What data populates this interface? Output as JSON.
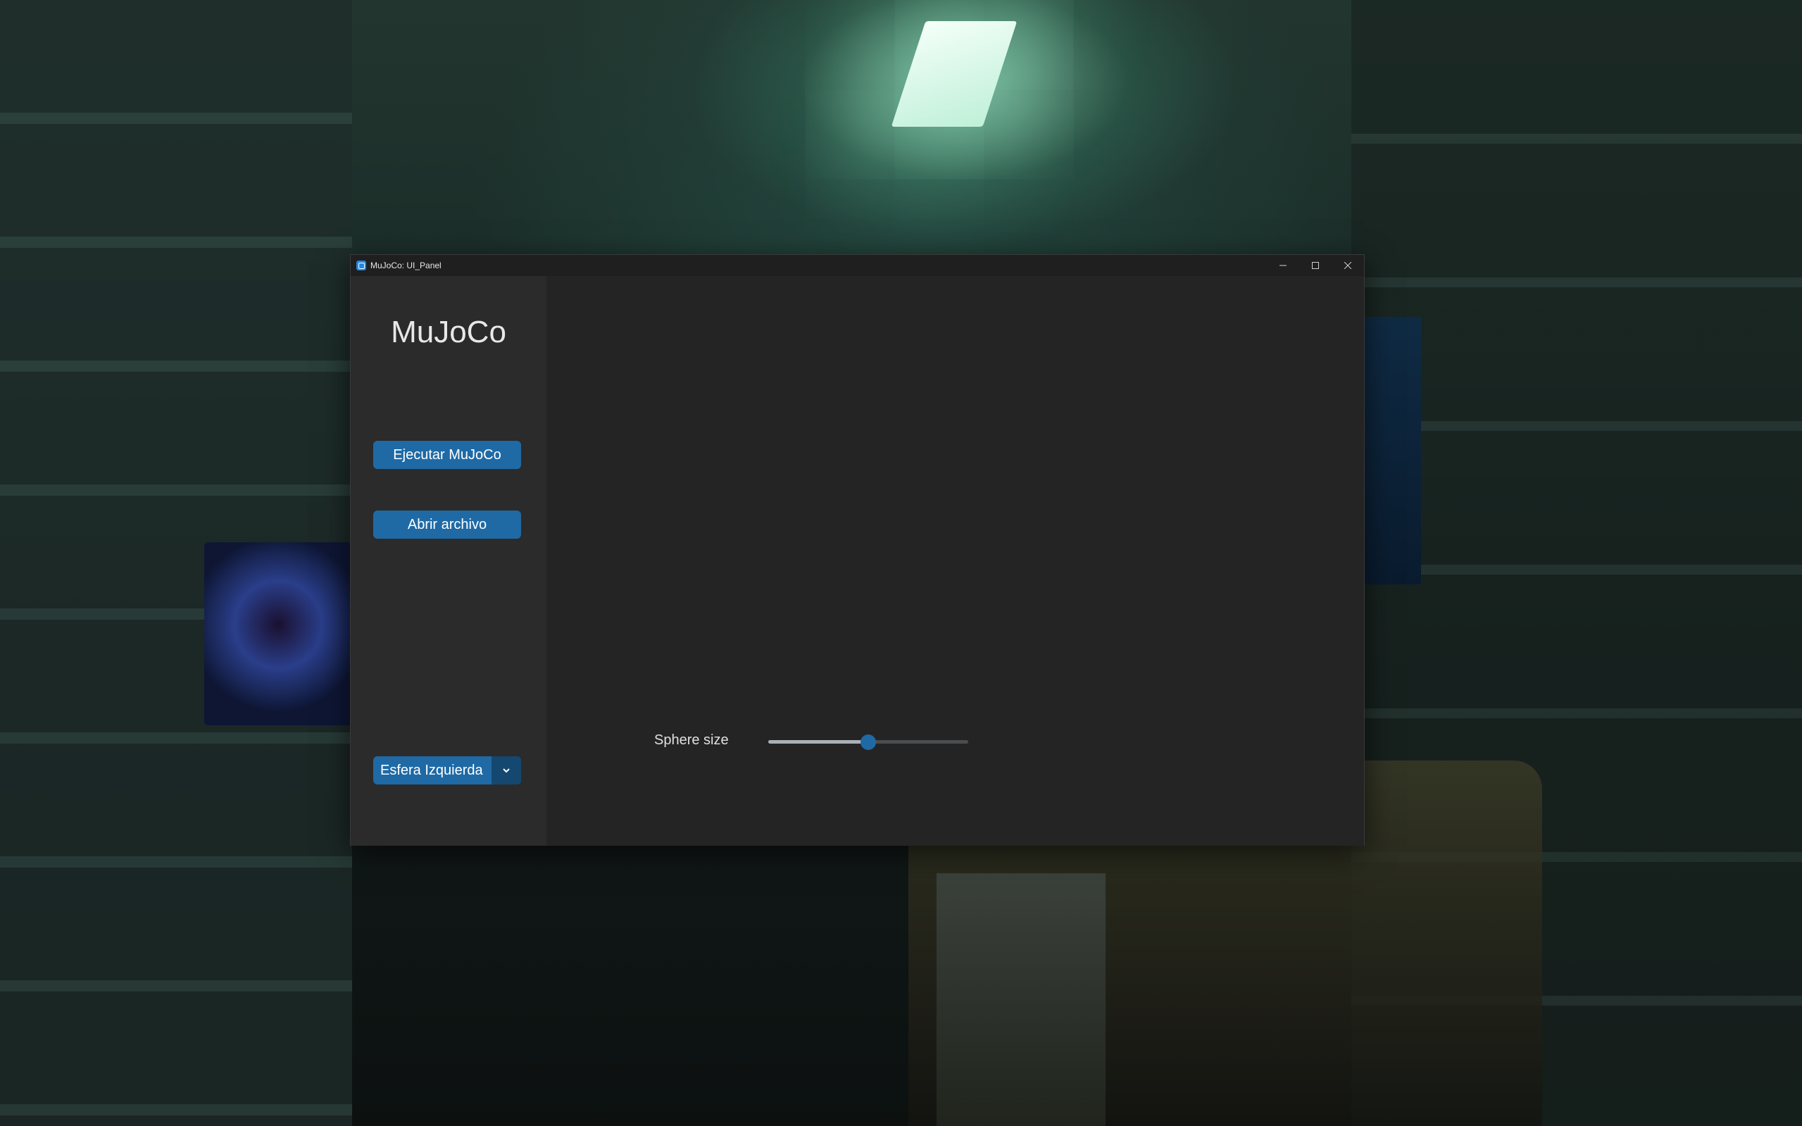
{
  "window": {
    "title": "MuJoCo: UI_Panel"
  },
  "sidebar": {
    "app_title": "MuJoCo",
    "run_button_label": "Ejecutar MuJoCo",
    "open_button_label": "Abrir archivo",
    "sphere_select": {
      "selected": "Esfera Izquierda"
    }
  },
  "main": {
    "slider": {
      "label": "Sphere size",
      "value_fraction": 0.5
    }
  },
  "colors": {
    "accent": "#1f6aa5",
    "accent_dark": "#144870",
    "window_bg": "#242424",
    "sidebar_bg": "#2b2b2b",
    "titlebar_bg": "#1f1f1f"
  },
  "icons": {
    "app": "mujoco-app-icon",
    "minimize": "minimize-icon",
    "maximize": "maximize-icon",
    "close": "close-icon",
    "dropdown": "chevron-down-icon"
  }
}
